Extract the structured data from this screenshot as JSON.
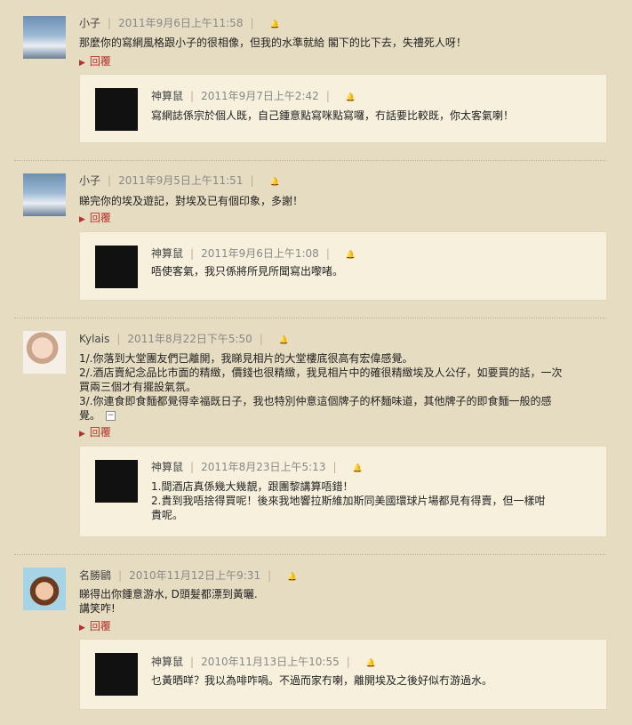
{
  "comments": [
    {
      "author": "小子",
      "date": "2011年9月6日上午11:58",
      "lines": [
        "那麼你的寫網風格跟小子的很相像，但我的水準就給 閣下的比下去，失禮死人呀！"
      ],
      "reply_label": "回覆",
      "avatar": "tower-photo-avatar",
      "reply": {
        "author": "神算鼠",
        "date": "2011年9月7日上午2:42",
        "lines": [
          "寫網誌係宗於個人既，自己鍾意點寫咪點寫囉，冇話要比較既，你太客氣喇！"
        ]
      }
    },
    {
      "author": "小子",
      "date": "2011年9月5日上午11:51",
      "lines": [
        "睇完你的埃及遊記，對埃及已有個印象，多謝！"
      ],
      "reply_label": "回覆",
      "avatar": "tower-photo-avatar",
      "reply": {
        "author": "神算鼠",
        "date": "2011年9月6日上午1:08",
        "lines": [
          "唔使客氣，我只係將所見所聞寫出嚟啫。"
        ]
      }
    },
    {
      "author": "Kylais",
      "date": "2011年8月22日下午5:50",
      "lines": [
        "1/.你落到大堂團友們已離開，我睇見相片的大堂樓底很高有宏偉感覺。",
        "2/.酒店賣紀念品比市面的精緻，價錢也很精緻，我見相片中的確很精緻埃及人公仔，如要買的話，一次",
        "買兩三個才有擺設氣氛。",
        "3/.你連食即食麵都覺得幸福既日子，我也特別仲意這個牌子的杯麵味道，其他牌子的即食麵一般的感",
        "覺。"
      ],
      "reply_label": "回覆",
      "avatar": "face-photo-avatar",
      "reply": {
        "author": "神算鼠",
        "date": "2011年8月23日上午5:13",
        "lines": [
          "1.間酒店真係幾大幾靚，跟團黎講算唔錯！",
          "2.貴到我唔捨得買呢！後來我地響拉斯維加斯同美國環球片場都見有得賣，但一樣咁",
          "貴呢。"
        ]
      }
    },
    {
      "author": "名勝鷗",
      "date": "2010年11月12日上午9:31",
      "lines": [
        "睇得出你鍾意游水, D頭髮都漂到黃曬.",
        "講笑咋!"
      ],
      "reply_label": "回覆",
      "avatar": "cartoon-avatar",
      "reply": {
        "author": "神算鼠",
        "date": "2010年11月13日上午10:55",
        "lines": [
          "乜黃晒咩？我以為啡咋喎。不過而家冇喇，離開埃及之後好似冇游過水。"
        ]
      }
    }
  ],
  "icons": {
    "bell": "bell-icon",
    "caret": "caret-right-icon",
    "collapse": "collapse-icon"
  },
  "colors": {
    "background": "#e6dcc1",
    "reply_bg": "#f6f0dd",
    "link": "#b4322a"
  }
}
